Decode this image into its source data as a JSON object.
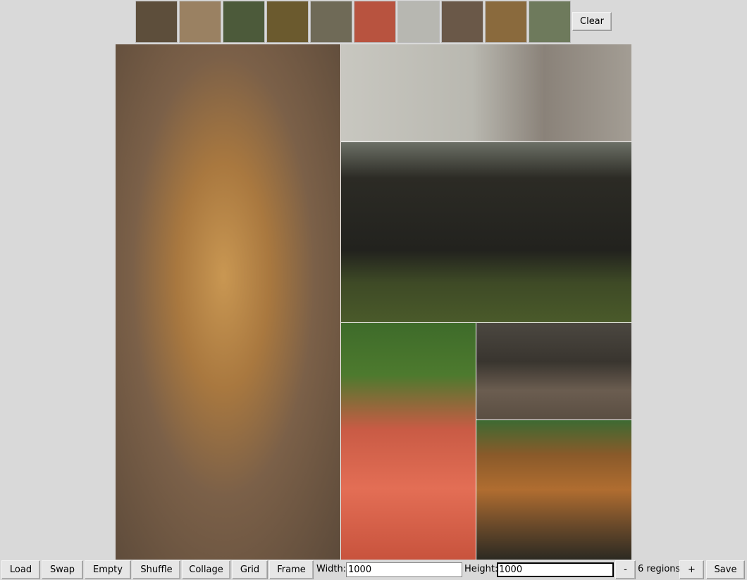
{
  "thumbnails": [
    {
      "name": "rhino-thumb",
      "color": "#5d4e3b"
    },
    {
      "name": "cheetah-thumb",
      "color": "#9a8162"
    },
    {
      "name": "giraffe-thumb",
      "color": "#4c5a3a"
    },
    {
      "name": "tiger-thumb",
      "color": "#6b5a2e"
    },
    {
      "name": "rhino-grass-thumb",
      "color": "#6f6a57"
    },
    {
      "name": "flamingos-thumb",
      "color": "#b8533f"
    },
    {
      "name": "ostrich-thumb",
      "color": "#b7b7b1"
    },
    {
      "name": "rhino-calf-thumb",
      "color": "#6a5848"
    },
    {
      "name": "giraffe-head-thumb",
      "color": "#8a6a3d"
    },
    {
      "name": "giraffe-fence-thumb",
      "color": "#6e7a5c"
    }
  ],
  "clear_label": "Clear",
  "collage": {
    "regions": [
      {
        "name": "cheetah",
        "bg": "radial-gradient(ellipse at 48% 45%, #c99752 0%, #a9783f 28%, #7b6048 55%, #5c4a3a 100%)"
      },
      {
        "name": "ostrich",
        "bg": "linear-gradient(90deg, #c8c7c0 0%, #b9b8b0 45%, #8a8279 70%, #a39d94 100%)"
      },
      {
        "name": "giraffe",
        "bg": "linear-gradient(180deg, #6c7066 0%, #2c2b25 20%, #22221e 60%, #3e4a26 78%, #4a5a2a 100%)"
      },
      {
        "name": "flamingos",
        "bg": "linear-gradient(180deg, #3e6b2a 0%, #4d7a2e 22%, #c95b45 45%, #e36e55 70%, #c8533d 100%)"
      },
      {
        "name": "rhinos",
        "bg": "linear-gradient(180deg, #4b4740 0%, #39352f 40%, #6b5d50 70%, #5a4e42 100%)"
      },
      {
        "name": "tiger",
        "bg": "linear-gradient(180deg, #3d6a32 0%, #8a5a2a 25%, #b06d30 50%, #6b4a2a 75%, #2c2a22 100%)"
      }
    ]
  },
  "toolbar": {
    "load": "Load",
    "swap": "Swap",
    "empty": "Empty",
    "shuffle": "Shuffle",
    "collage": "Collage",
    "grid": "Grid",
    "frame": "Frame",
    "width_label": "Width:",
    "width_value": "1000",
    "height_label": "Height:",
    "height_value": "1000",
    "minus": "-",
    "regions_text": "6 regions",
    "plus": "+",
    "save": "Save"
  }
}
